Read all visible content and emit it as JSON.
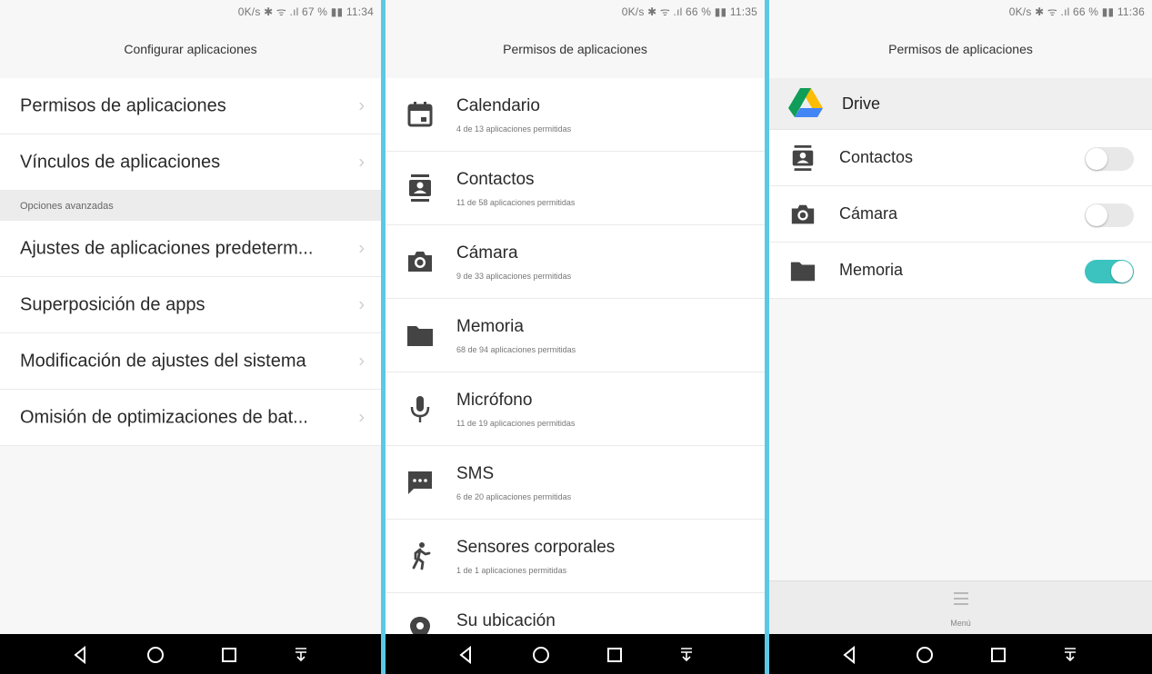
{
  "panel1": {
    "status": "0K/s ✱ ᯤ .ıl 67 % ▮▮ 11:34",
    "title": "Configurar aplicaciones",
    "items_top": [
      {
        "label": "Permisos de aplicaciones"
      },
      {
        "label": "Vínculos de aplicaciones"
      }
    ],
    "section": "Opciones avanzadas",
    "items_bottom": [
      {
        "label": "Ajustes de aplicaciones predeterm..."
      },
      {
        "label": "Superposición de apps"
      },
      {
        "label": "Modificación de ajustes del sistema"
      },
      {
        "label": "Omisión de optimizaciones de bat..."
      }
    ]
  },
  "panel2": {
    "status": "0K/s ✱ ᯤ .ıl 66 % ▮▮ 11:35",
    "title": "Permisos de aplicaciones",
    "items": [
      {
        "title": "Calendario",
        "sub": "4 de 13 aplicaciones permitidas",
        "icon": "calendar-icon"
      },
      {
        "title": "Contactos",
        "sub": "11 de 58 aplicaciones permitidas",
        "icon": "contacts-icon"
      },
      {
        "title": "Cámara",
        "sub": "9 de 33 aplicaciones permitidas",
        "icon": "camera-icon"
      },
      {
        "title": "Memoria",
        "sub": "68 de 94 aplicaciones permitidas",
        "icon": "folder-icon"
      },
      {
        "title": "Micrófono",
        "sub": "11 de 19 aplicaciones permitidas",
        "icon": "microphone-icon"
      },
      {
        "title": "SMS",
        "sub": "6 de 20 aplicaciones permitidas",
        "icon": "sms-icon"
      },
      {
        "title": "Sensores corporales",
        "sub": "1 de 1 aplicaciones permitidas",
        "icon": "body-sensor-icon"
      },
      {
        "title": "Su ubicación",
        "sub": "",
        "icon": "location-icon"
      }
    ]
  },
  "panel3": {
    "status": "0K/s ✱ ᯤ .ıl 66 % ▮▮ 11:36",
    "title": "Permisos de aplicaciones",
    "app": "Drive",
    "permissions": [
      {
        "label": "Contactos",
        "enabled": false,
        "icon": "contacts-icon"
      },
      {
        "label": "Cámara",
        "enabled": false,
        "icon": "camera-icon"
      },
      {
        "label": "Memoria",
        "enabled": true,
        "icon": "folder-icon"
      }
    ],
    "menu_label": "Menú"
  },
  "colors": {
    "divider": "#5bc8e4",
    "toggle_on": "#3cc3c0",
    "navbar": "#000000"
  }
}
